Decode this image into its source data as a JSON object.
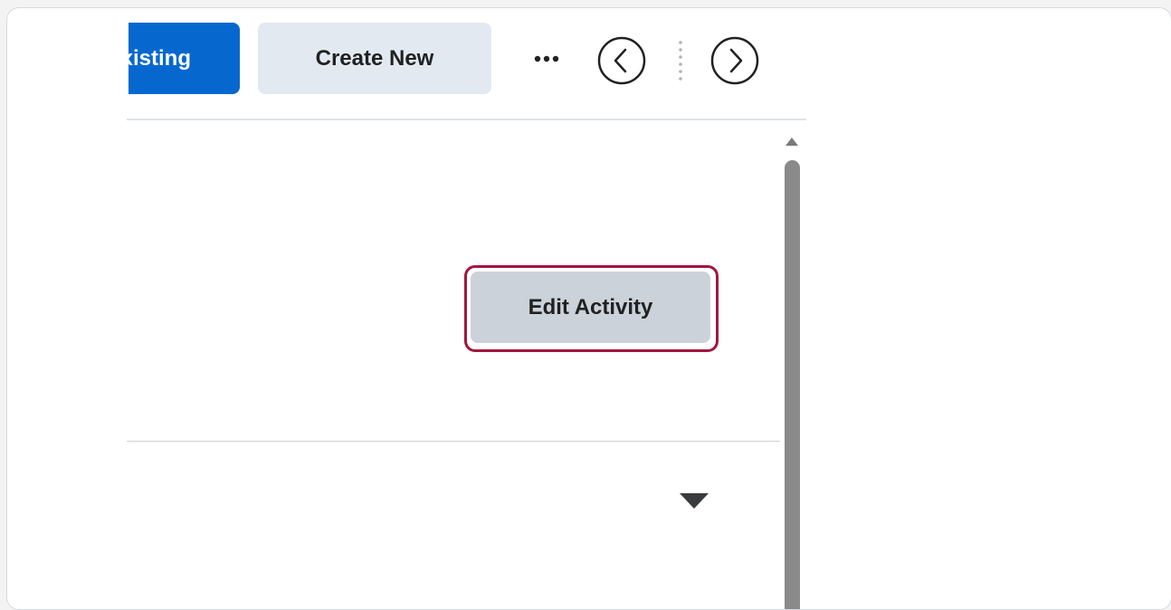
{
  "toolbar": {
    "add_existing_label": "Add Existing",
    "create_new_label": "Create New",
    "more_icon": "more-horizontal-icon",
    "prev_icon": "chevron-left-circle-icon",
    "next_icon": "chevron-right-circle-icon"
  },
  "activity": {
    "edit_label": "Edit Activity",
    "dropdown_icon": "caret-down-icon"
  },
  "colors": {
    "primary_blue": "#0668cf",
    "secondary_button": "#e3e9f1",
    "edit_button": "#cbd2da",
    "highlight_border": "#a3163e",
    "scrollbar": "#8a8a8a"
  }
}
